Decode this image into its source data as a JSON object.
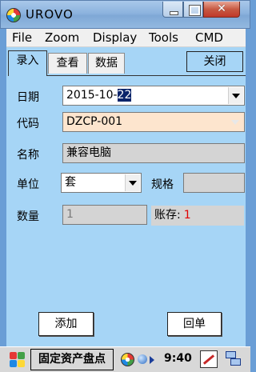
{
  "window": {
    "title": "UROVO",
    "icon": "urovo-logo-icon"
  },
  "menu": {
    "items": [
      "File",
      "Zoom",
      "Display",
      "Tools",
      "CMD"
    ]
  },
  "tabs": [
    {
      "label": "录入",
      "active": true
    },
    {
      "label": "查看",
      "active": false
    },
    {
      "label": "数据",
      "active": false
    }
  ],
  "close_button": "关闭",
  "form": {
    "date": {
      "label": "日期",
      "value_prefix": "2015-10-",
      "value_selected": "22"
    },
    "code": {
      "label": "代码",
      "value": "DZCP-001"
    },
    "name": {
      "label": "名称",
      "value": "兼容电脑"
    },
    "unit": {
      "label": "单位",
      "value": "套"
    },
    "spec": {
      "label": "规格",
      "value": ""
    },
    "quantity": {
      "label": "数量",
      "value": "1"
    },
    "stock": {
      "label": "账存:",
      "value": "1"
    }
  },
  "buttons": {
    "add": "添加",
    "return": "回单"
  },
  "taskbar": {
    "task": "固定资产盘点",
    "clock": "9:40"
  },
  "colors": {
    "client_bg": "#a6d5f6",
    "code_field_bg": "#fde5ce",
    "selection": "#0a246a",
    "stock_value": "#e00000"
  }
}
